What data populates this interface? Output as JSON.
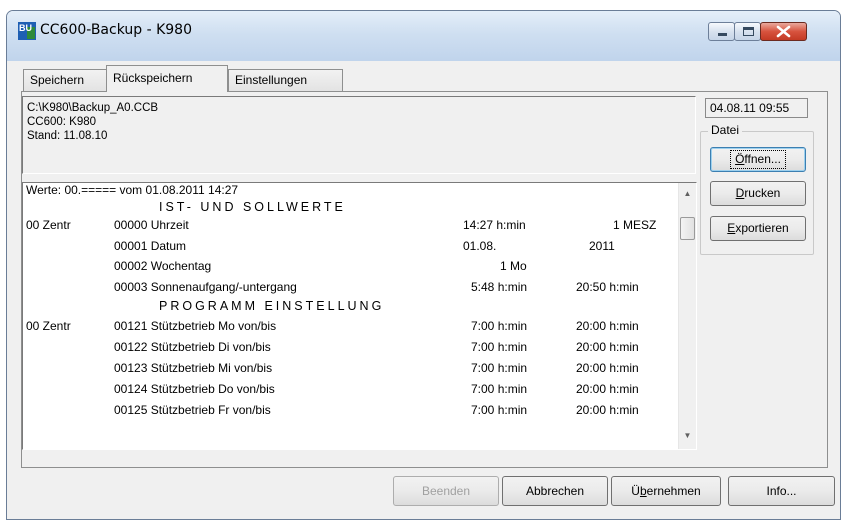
{
  "window": {
    "title": "CC600-Backup - K980",
    "icon_text": "BU"
  },
  "tabs": [
    {
      "label": "Speichern",
      "active": false
    },
    {
      "label": "Rückspeichern",
      "active": true
    },
    {
      "label": "Einstellungen",
      "active": false
    }
  ],
  "header_info": {
    "path": "C:\\K980\\Backup_A0.CCB",
    "device": "CC600: K980",
    "stand": "Stand: 11.08.10"
  },
  "clock": "04.08.11 09:55",
  "datei_group": {
    "label": "Datei",
    "open_button": {
      "pre": "",
      "mnemonic": "Ö",
      "post": "ffnen..."
    },
    "print_button": {
      "pre": "",
      "mnemonic": "D",
      "post": "rucken"
    },
    "export_button": {
      "pre": "",
      "mnemonic": "E",
      "post": "xportieren"
    }
  },
  "values_list": {
    "header_line": "Werte: 00.===== vom  01.08.2011 14:27",
    "section1_title": "IST- UND SOLLWERTE",
    "section2_title": "PROGRAMM EINSTELLUNG",
    "rows1": [
      {
        "group": "00 Zentr",
        "code": "00000 Uhrzeit",
        "val1": "14:27 h:min",
        "val2": "1 MESZ"
      },
      {
        "group": "",
        "code": "00001 Datum",
        "val1": "01.08.",
        "val2": "2011"
      },
      {
        "group": "",
        "code": "00002 Wochentag",
        "val1": "1 Mo",
        "val2": ""
      },
      {
        "group": "",
        "code": "00003 Sonnenaufgang/-untergang",
        "val1": "5:48 h:min",
        "val2": "20:50 h:min"
      }
    ],
    "rows2": [
      {
        "group": "00 Zentr",
        "code": "00121 Stützbetrieb Mo von/bis",
        "val1": "7:00 h:min",
        "val2": "20:00 h:min"
      },
      {
        "group": "",
        "code": "00122 Stützbetrieb Di von/bis",
        "val1": "7:00 h:min",
        "val2": "20:00 h:min"
      },
      {
        "group": "",
        "code": "00123 Stützbetrieb Mi von/bis",
        "val1": "7:00 h:min",
        "val2": "20:00 h:min"
      },
      {
        "group": "",
        "code": "00124 Stützbetrieb Do von/bis",
        "val1": "7:00 h:min",
        "val2": "20:00 h:min"
      },
      {
        "group": "",
        "code": "00125 Stützbetrieb Fr von/bis",
        "val1": "7:00 h:min",
        "val2": "20:00 h:min"
      }
    ]
  },
  "bottom_buttons": {
    "beenden": "Beenden",
    "abbrechen": "Abbrechen",
    "uebernehmen": {
      "pre": "Ü",
      "mnemonic": "b",
      "post": "ernehmen"
    },
    "info": "Info..."
  },
  "colors": {
    "titlebar": "#cfdff1",
    "close_button": "#d7533e",
    "window_bg": "#f0f0f0"
  },
  "icons": [
    "app-icon",
    "minimize-icon",
    "maximize-icon",
    "close-icon",
    "scroll-up-arrow-icon",
    "scroll-down-arrow-icon"
  ]
}
